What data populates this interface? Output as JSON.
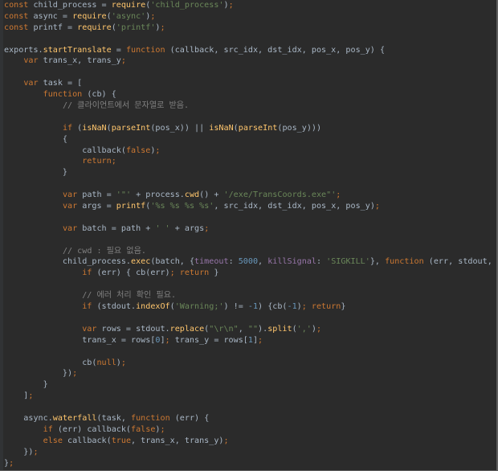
{
  "editor": {
    "background": "#2b2b2b",
    "text_color": "#a9b7c6",
    "lines": [
      [
        [
          "#cc7832",
          "const"
        ],
        " child_process = ",
        [
          "#ffc66d",
          "require"
        ],
        "(",
        [
          "#6a8759",
          "'child_process'"
        ],
        ")",
        [
          "#cc7832",
          ";"
        ]
      ],
      [
        [
          "#cc7832",
          "const"
        ],
        " async = ",
        [
          "#ffc66d",
          "require"
        ],
        "(",
        [
          "#6a8759",
          "'async'"
        ],
        ")",
        [
          "#cc7832",
          ";"
        ]
      ],
      [
        [
          "#cc7832",
          "const"
        ],
        " printf = ",
        [
          "#ffc66d",
          "require"
        ],
        "(",
        [
          "#6a8759",
          "'printf'"
        ],
        ")",
        [
          "#cc7832",
          ";"
        ]
      ],
      [],
      [
        "exports.",
        [
          "#ffc66d",
          "startTranslate"
        ],
        " = ",
        [
          "#cc7832",
          "function"
        ],
        " (callback, src_idx, dst_idx, pos_x, pos_y) {"
      ],
      [
        "    ",
        [
          "#cc7832",
          "var"
        ],
        " trans_x, trans_y",
        [
          "#cc7832",
          ";"
        ]
      ],
      [],
      [
        "    ",
        [
          "#cc7832",
          "var"
        ],
        " task = ["
      ],
      [
        "        ",
        [
          "#cc7832",
          "function"
        ],
        " (cb) {"
      ],
      [
        "            ",
        [
          "#808080",
          "// 클라이언트에서 문자열로 받음."
        ]
      ],
      [],
      [
        "            ",
        [
          "#cc7832",
          "if"
        ],
        " (",
        [
          "#ffc66d",
          "isNaN"
        ],
        "(",
        [
          "#ffc66d",
          "parseInt"
        ],
        "(pos_x)) || ",
        [
          "#ffc66d",
          "isNaN"
        ],
        "(",
        [
          "#ffc66d",
          "parseInt"
        ],
        "(pos_y)))"
      ],
      [
        "            {"
      ],
      [
        "                callback(",
        [
          "#cc7832",
          "false"
        ],
        ")",
        [
          "#cc7832",
          ";"
        ]
      ],
      [
        "                ",
        [
          "#cc7832",
          "return;"
        ]
      ],
      [
        "            }"
      ],
      [],
      [
        "            ",
        [
          "#cc7832",
          "var"
        ],
        " path = ",
        [
          "#6a8759",
          "'\"'"
        ],
        " + process.",
        [
          "#ffc66d",
          "cwd"
        ],
        "() + ",
        [
          "#6a8759",
          "'/exe/TransCoords.exe\"'"
        ],
        [
          "#cc7832",
          ";"
        ]
      ],
      [
        "            ",
        [
          "#cc7832",
          "var"
        ],
        " args = ",
        [
          "#ffc66d",
          "printf"
        ],
        "(",
        [
          "#6a8759",
          "'%s %s %s %s'"
        ],
        ", src_idx, dst_idx, pos_x, pos_y)",
        [
          "#cc7832",
          ";"
        ]
      ],
      [],
      [
        "            ",
        [
          "#cc7832",
          "var"
        ],
        " batch = path + ",
        [
          "#6a8759",
          "' '"
        ],
        " + args",
        [
          "#cc7832",
          ";"
        ]
      ],
      [],
      [
        "            ",
        [
          "#808080",
          "// cwd : 필요 없음."
        ]
      ],
      [
        "            child_process.",
        [
          "#ffc66d",
          "exec"
        ],
        "(batch, {",
        [
          "#9876aa",
          "timeout"
        ],
        ": ",
        [
          "#6897bb",
          "5000"
        ],
        ", ",
        [
          "#9876aa",
          "killSignal"
        ],
        ": ",
        [
          "#6a8759",
          "'SIGKILL'"
        ],
        "}, ",
        [
          "#cc7832",
          "function"
        ],
        " (err, stdout,"
      ],
      [
        "                ",
        [
          "#cc7832",
          "if"
        ],
        " (err) { cb(err)",
        [
          "#cc7832",
          ";"
        ],
        " ",
        [
          "#cc7832",
          "return"
        ],
        " }"
      ],
      [],
      [
        "                ",
        [
          "#808080",
          "// 에러 처리 확인 필요."
        ]
      ],
      [
        "                ",
        [
          "#cc7832",
          "if"
        ],
        " (stdout.",
        [
          "#ffc66d",
          "indexOf"
        ],
        "(",
        [
          "#6a8759",
          "'Warning;'"
        ],
        ") != ",
        [
          "#6897bb",
          "-1"
        ],
        ") {cb(",
        [
          "#6897bb",
          "-1"
        ],
        ")",
        [
          "#cc7832",
          ";"
        ],
        " ",
        [
          "#cc7832",
          "return"
        ],
        "}"
      ],
      [],
      [
        "                ",
        [
          "#cc7832",
          "var"
        ],
        " rows = stdout.",
        [
          "#ffc66d",
          "replace"
        ],
        "(",
        [
          "#6a8759",
          "\"\\r\\n\""
        ],
        ", ",
        [
          "#6a8759",
          "\"\""
        ],
        ").",
        [
          "#ffc66d",
          "split"
        ],
        "(",
        [
          "#6a8759",
          "','"
        ],
        ")",
        [
          "#cc7832",
          ";"
        ]
      ],
      [
        "                trans_x = rows[",
        [
          "#6897bb",
          "0"
        ],
        "]",
        [
          "#cc7832",
          ";"
        ],
        " trans_y = rows[",
        [
          "#6897bb",
          "1"
        ],
        "]",
        [
          "#cc7832",
          ";"
        ]
      ],
      [],
      [
        "                cb(",
        [
          "#cc7832",
          "null"
        ],
        ")",
        [
          "#cc7832",
          ";"
        ]
      ],
      [
        "            })",
        [
          "#cc7832",
          ";"
        ]
      ],
      [
        "        }"
      ],
      [
        "    ]",
        [
          "#cc7832",
          ";"
        ]
      ],
      [],
      [
        "    async.",
        [
          "#ffc66d",
          "waterfall"
        ],
        "(task, ",
        [
          "#cc7832",
          "function"
        ],
        " (err) {"
      ],
      [
        "        ",
        [
          "#cc7832",
          "if"
        ],
        " (err) callback(",
        [
          "#cc7832",
          "false"
        ],
        ")",
        [
          "#cc7832",
          ";"
        ]
      ],
      [
        "        ",
        [
          "#cc7832",
          "else"
        ],
        " callback(",
        [
          "#cc7832",
          "true"
        ],
        ", trans_x, trans_y)",
        [
          "#cc7832",
          ";"
        ]
      ],
      [
        "    })",
        [
          "#cc7832",
          ";"
        ]
      ],
      [
        "}",
        [
          "#cc7832",
          ";"
        ]
      ]
    ]
  }
}
